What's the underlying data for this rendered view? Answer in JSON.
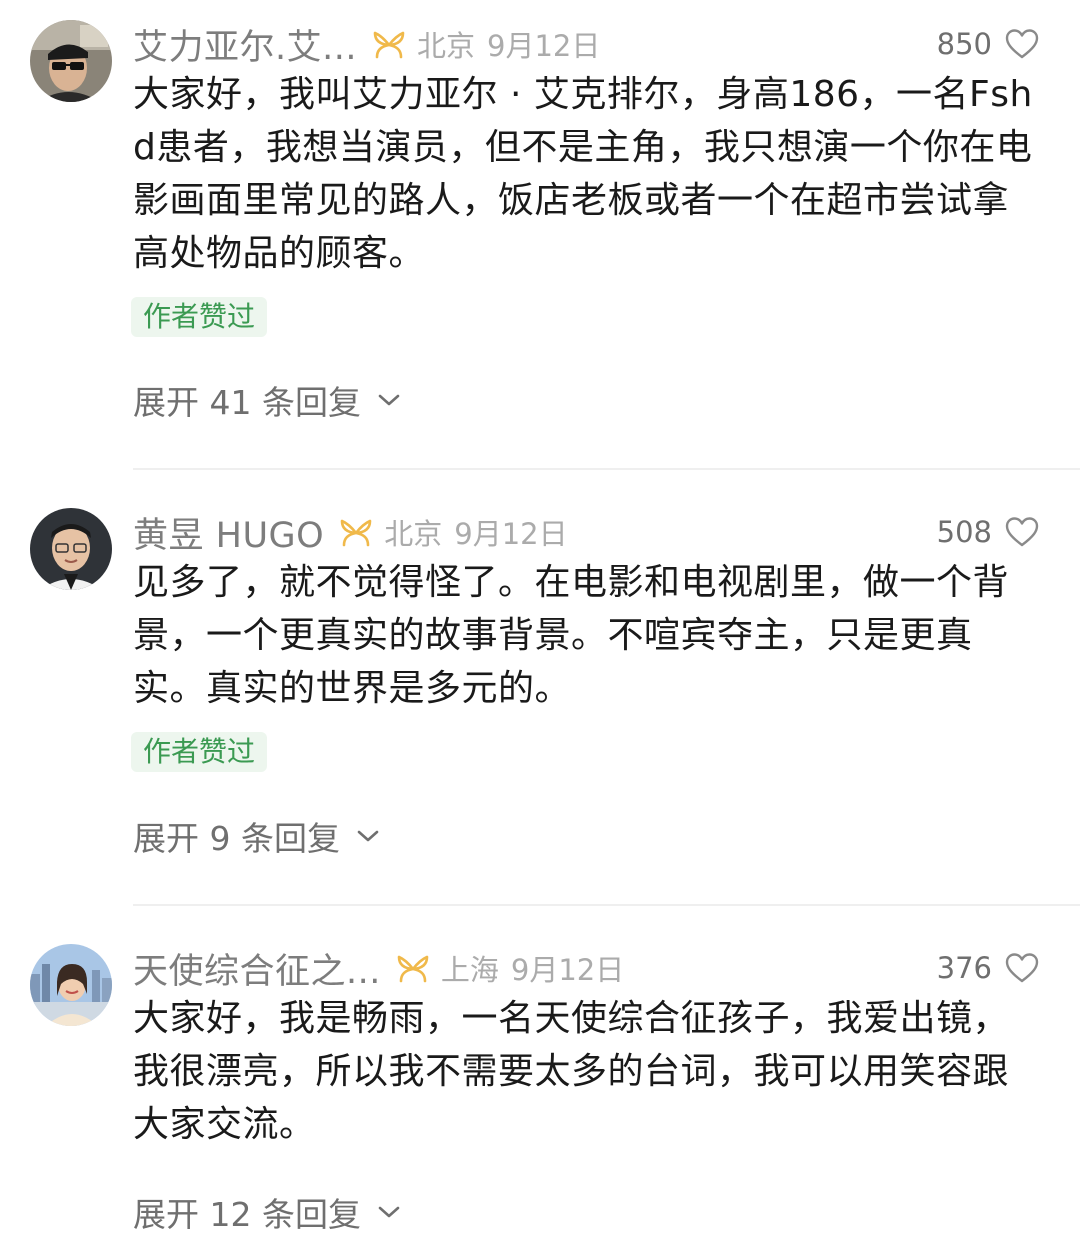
{
  "comments": [
    {
      "username": "艾力亚尔.艾...",
      "location": "北京",
      "date": "9月12日",
      "likes": "850",
      "text": "大家好，我叫艾力亚尔 · 艾克排尔，身高186，一名Fshd患者，我想当演员，但不是主角，我只想演一个你在电影画面里常见的路人，饭店老板或者一个在超市尝试拿高处物品的顾客。",
      "author_liked": "作者赞过",
      "expand": "展开 41 条回复"
    },
    {
      "username": "黄昱 HUGO",
      "location": "北京",
      "date": "9月12日",
      "likes": "508",
      "text": "见多了，就不觉得怪了。在电影和电视剧里，做一个背景，一个更真实的故事背景。不喧宾夺主，只是更真实。真实的世界是多元的。",
      "author_liked": "作者赞过",
      "expand": "展开 9 条回复"
    },
    {
      "username": "天使综合征之...",
      "location": "上海",
      "date": "9月12日",
      "likes": "376",
      "text": "大家好，我是畅雨，一名天使综合征孩子，我爱出镜，我很漂亮，所以我不需要太多的台词，我可以用笑容跟大家交流。",
      "expand": "展开 12 条回复"
    }
  ],
  "icons": {
    "badge": "ribbon-badge-icon",
    "like": "heart-outline-icon",
    "expand": "chevron-down-icon"
  },
  "colors": {
    "author_liked_text": "#3b9a52",
    "author_liked_bg": "#edf6ee",
    "badge": "#f0b94a",
    "meta_gray": "#ababab"
  }
}
